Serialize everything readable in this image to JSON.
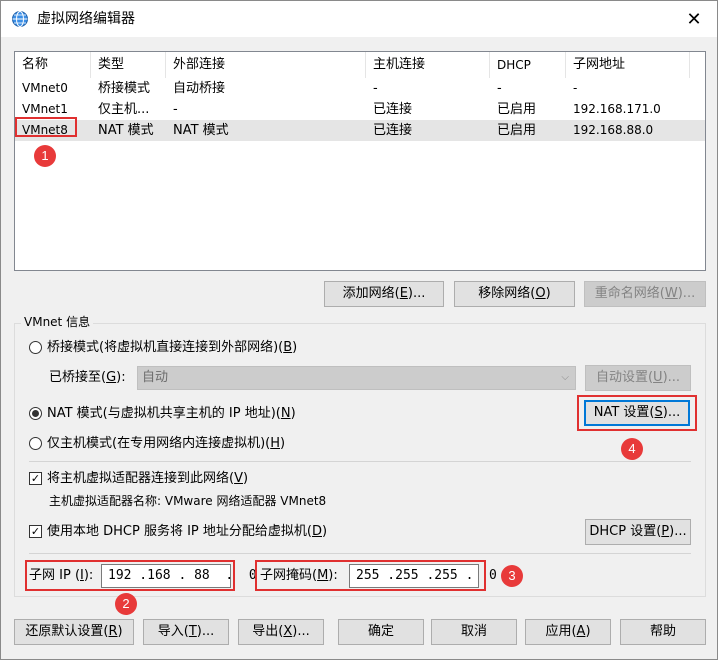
{
  "window": {
    "title": "虚拟网络编辑器",
    "close_glyph": "✕",
    "icon": "network-globe-icon"
  },
  "network_list": {
    "columns": [
      "名称",
      "类型",
      "外部连接",
      "主机连接",
      "DHCP",
      "子网地址"
    ],
    "rows": [
      {
        "name": "VMnet0",
        "type": "桥接模式",
        "external": "自动桥接",
        "host": "-",
        "dhcp": "-",
        "subnet": "-"
      },
      {
        "name": "VMnet1",
        "type": "仅主机...",
        "external": "-",
        "host": "已连接",
        "dhcp": "已启用",
        "subnet": "192.168.171.0"
      },
      {
        "name": "VMnet8",
        "type": "NAT 模式",
        "external": "NAT 模式",
        "host": "已连接",
        "dhcp": "已启用",
        "subnet": "192.168.88.0"
      }
    ],
    "selected_row": "VMnet8"
  },
  "list_buttons": {
    "add_prefix": "添加网络(",
    "add_key": "E",
    "add_suffix": ")...",
    "remove_prefix": "移除网络(",
    "remove_key": "O",
    "remove_suffix": ")",
    "rename_prefix": "重命名网络(",
    "rename_key": "W",
    "rename_suffix": ")..."
  },
  "vmnet_info": {
    "group_title": "VMnet 信息",
    "bridge_prefix": "桥接模式(将虚拟机直接连接到外部网络)(",
    "bridge_key": "B",
    "bridge_suffix": ")",
    "bridged_to_prefix": "已桥接至(",
    "bridged_to_key": "G",
    "bridged_to_suffix": "):",
    "bridged_to_value": "自动",
    "auto_settings_prefix": "自动设置(",
    "auto_settings_key": "U",
    "auto_settings_suffix": ")...",
    "nat_prefix": "NAT 模式(与虚拟机共享主机的 IP 地址)(",
    "nat_key": "N",
    "nat_suffix": ")",
    "nat_settings_prefix": "NAT 设置(",
    "nat_settings_key": "S",
    "nat_settings_suffix": ")...",
    "hostonly_prefix": "仅主机模式(在专用网络内连接虚拟机)(",
    "hostonly_key": "H",
    "hostonly_suffix": ")",
    "connect_adapter_prefix": "将主机虚拟适配器连接到此网络(",
    "connect_adapter_key": "V",
    "connect_adapter_suffix": ")",
    "adapter_name_label": "主机虚拟适配器名称: VMware 网络适配器 VMnet8",
    "use_dhcp_prefix": "使用本地 DHCP 服务将 IP 地址分配给虚拟机(",
    "use_dhcp_key": "D",
    "use_dhcp_suffix": ")",
    "dhcp_settings_prefix": "DHCP 设置(",
    "dhcp_settings_key": "P",
    "dhcp_settings_suffix": ")...",
    "subnet_ip_prefix": "子网 IP (",
    "subnet_ip_key": "I",
    "subnet_ip_suffix": "):",
    "subnet_ip_value": "192 .168 . 88  .  0",
    "subnet_mask_prefix": "子网掩码(",
    "subnet_mask_key": "M",
    "subnet_mask_suffix": "):",
    "subnet_mask_value": "255 .255 .255 .  0",
    "selected_mode": "nat",
    "connect_adapter_checked": true,
    "use_dhcp_checked": true
  },
  "bottom_buttons": {
    "restore_prefix": "还原默认设置(",
    "restore_key": "R",
    "restore_suffix": ")",
    "import_prefix": "导入(",
    "import_key": "T",
    "import_suffix": ")...",
    "export_prefix": "导出(",
    "export_key": "X",
    "export_suffix": ")...",
    "ok": "确定",
    "cancel": "取消",
    "apply_prefix": "应用(",
    "apply_key": "A",
    "apply_suffix": ")",
    "help": "帮助"
  },
  "annotations": {
    "marker_1": "1",
    "marker_2": "2",
    "marker_3": "3",
    "marker_4": "4",
    "color": "#e03030"
  },
  "check_glyph": "✓",
  "dropdown_glyph": "⌵"
}
